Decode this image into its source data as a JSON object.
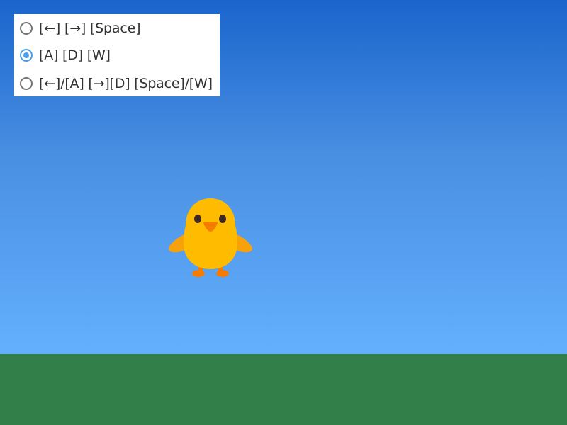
{
  "scene": {
    "sky_color_top": "#1a65cd",
    "sky_color_bottom": "#64affe",
    "ground_color": "#337f4a"
  },
  "controls": {
    "selected_index": 1,
    "options": [
      {
        "label": "[←] [→] [Space]"
      },
      {
        "label": "[A] [D] [W]"
      },
      {
        "label": "[←]/[A] [→][D] [Space]/[W]"
      }
    ]
  },
  "player": {
    "icon": "chick-icon"
  }
}
